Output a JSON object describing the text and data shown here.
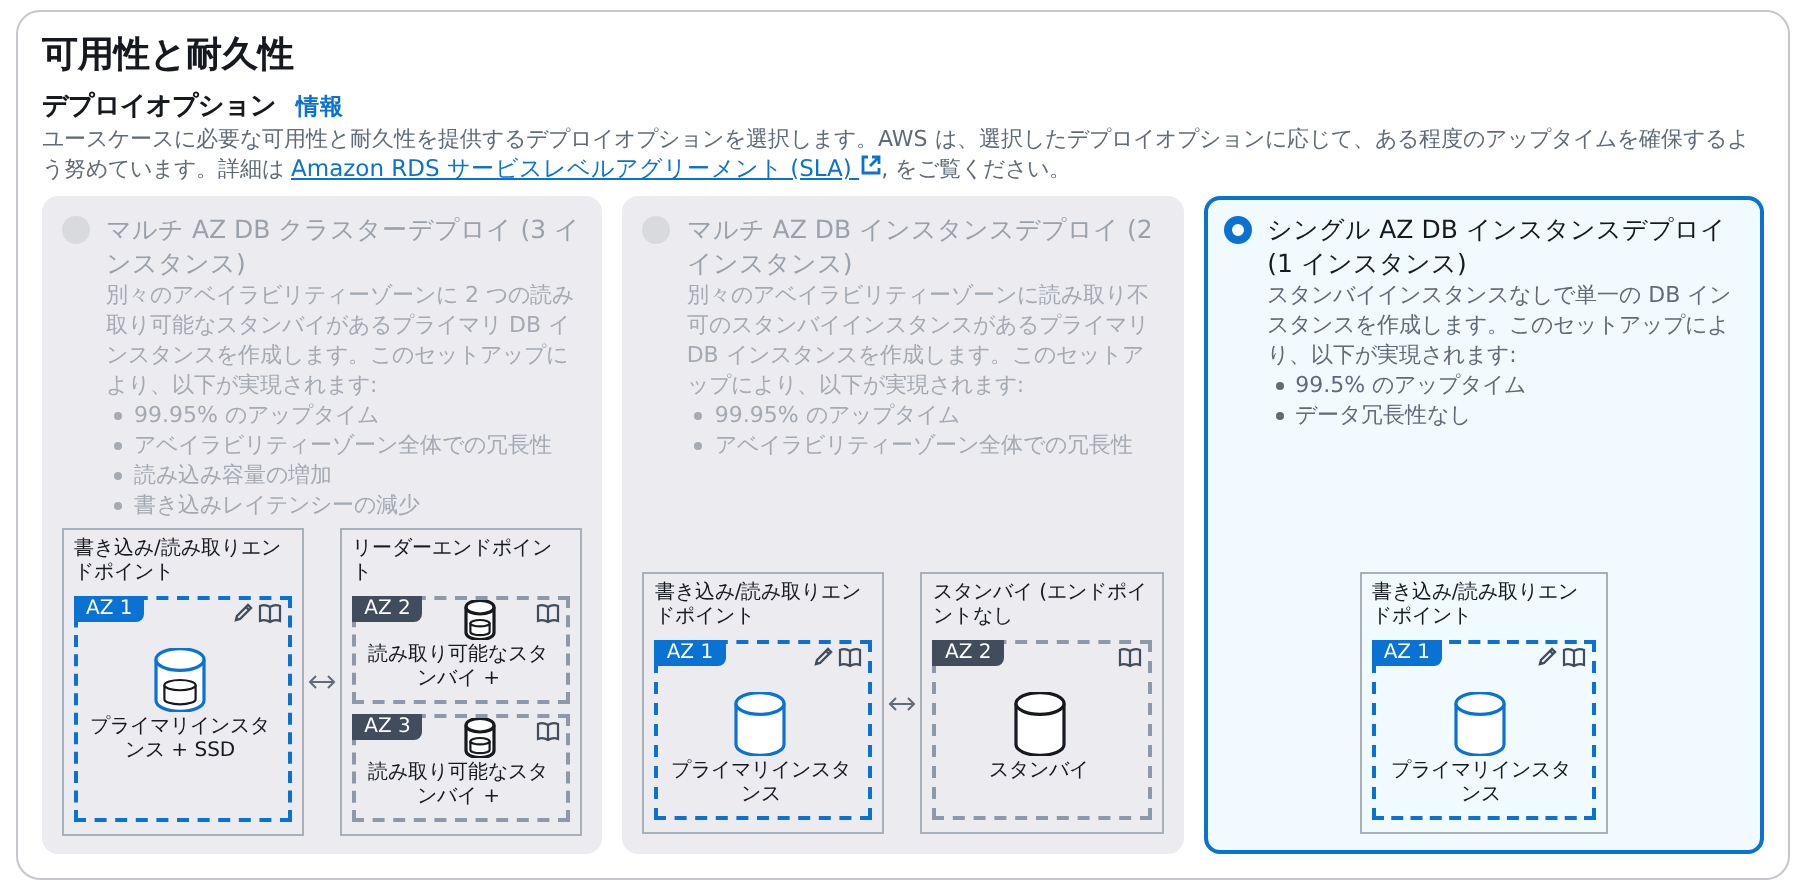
{
  "section": {
    "title": "可用性と耐久性"
  },
  "deployment": {
    "label": "デプロイオプション",
    "info_link": "情報",
    "description": "ユースケースに必要な可用性と耐久性を提供するデプロイオプションを選択します。AWS は、選択したデプロイオプションに応じて、ある程度のアップタイムを確保するよう努めています。詳細は ",
    "link": "Amazon RDS サービスレベルアグリーメント (SLA)",
    "description_end": ", をご覧ください。"
  },
  "cards": [
    {
      "title": "マルチ AZ DB クラスターデプロイ (3 インスタンス)",
      "selected": false,
      "disabled": true,
      "description": "別々のアベイラビリティーゾーンに 2 つの読み取り可能なスタンバイがあるプライマリ DB インスタンスを作成します。このセットアップにより、以下が実現されます:",
      "bullets": [
        "99.95% のアップタイム",
        "アベイラビリティーゾーン全体での冗長性",
        "読み込み容量の増加",
        "書き込みレイテンシーの減少"
      ],
      "diagram": {
        "connector": true,
        "panels": [
          {
            "title": "書き込み/読み取りエンドポイント",
            "zones": [
              {
                "badge": "AZ 1",
                "highlighted": true,
                "editable": true,
                "storage": true,
                "label": "プライマリインスタンス + SSD"
              }
            ]
          },
          {
            "title": "リーダーエンドポイント",
            "zones": [
              {
                "badge": "AZ 2",
                "highlighted": false,
                "editable": false,
                "storage": true,
                "label": "読み取り可能なスタンバイ +"
              },
              {
                "badge": "AZ 3",
                "highlighted": false,
                "editable": false,
                "storage": true,
                "label": "読み取り可能なスタンバイ +"
              }
            ]
          }
        ]
      }
    },
    {
      "title": "マルチ AZ DB インスタンスデプロイ (2 インスタンス)",
      "selected": false,
      "disabled": true,
      "description": "別々のアベイラビリティーゾーンに読み取り不可のスタンバイインスタンスがあるプライマリ DB インスタンスを作成します。このセットアップにより、以下が実現されます:",
      "bullets": [
        "99.95% のアップタイム",
        "アベイラビリティーゾーン全体での冗長性"
      ],
      "diagram": {
        "connector": true,
        "panels": [
          {
            "title": "書き込み/読み取りエンドポイント",
            "zones": [
              {
                "badge": "AZ 1",
                "highlighted": true,
                "editable": true,
                "storage": false,
                "label": "プライマリインスタンス"
              }
            ]
          },
          {
            "title": "スタンバイ (エンドポイントなし",
            "zones": [
              {
                "badge": "AZ 2",
                "highlighted": false,
                "editable": false,
                "storage": false,
                "label": "スタンバイ"
              }
            ]
          }
        ]
      }
    },
    {
      "title": "シングル AZ DB インスタンスデプロイ (1 インスタンス)",
      "selected": true,
      "disabled": false,
      "description": "スタンバイインスタンスなしで単一の DB インスタンスを作成します。このセットアップにより、以下が実現されます:",
      "bullets": [
        "99.5% のアップタイム",
        "データ冗長性なし"
      ],
      "diagram": {
        "panels": [
          {
            "title": "書き込み/読み取りエンドポイント",
            "zones": [
              {
                "badge": "AZ 1",
                "highlighted": true,
                "editable": true,
                "storage": false,
                "label": "プライマリインスタンス"
              }
            ]
          }
        ]
      }
    }
  ]
}
